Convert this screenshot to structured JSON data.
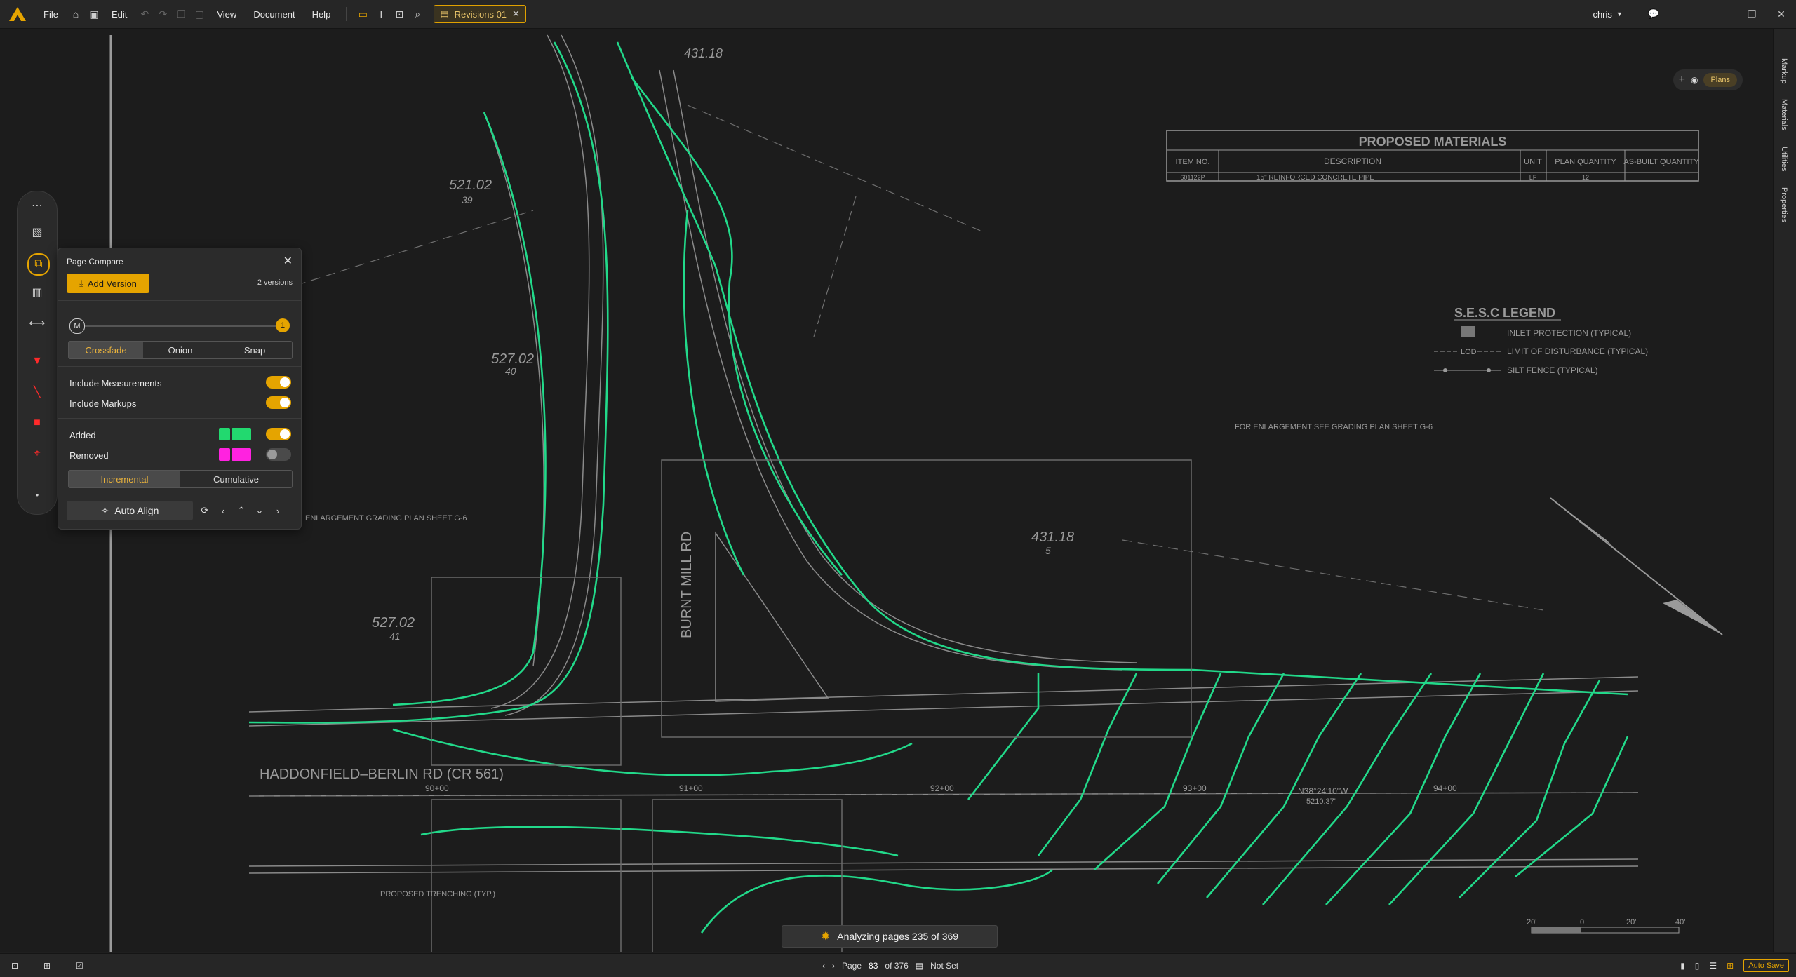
{
  "app": {
    "menus": [
      "File",
      "Edit",
      "View",
      "Document",
      "Help"
    ],
    "tab": {
      "label": "Revisions 01"
    },
    "user": "chris"
  },
  "right_panel_tabs": [
    "Markup",
    "Materials",
    "Utilities",
    "Properties"
  ],
  "top_right": {
    "pill": "Plans"
  },
  "page_compare": {
    "title": "Page Compare",
    "add_version_label": "Add Version",
    "versions_count": "2 versions",
    "slider": {
      "left_marker": "M",
      "right_marker": "1"
    },
    "modes": [
      "Crossfade",
      "Onion",
      "Snap"
    ],
    "active_mode": "Crossfade",
    "include_measurements": {
      "label": "Include Measurements",
      "on": true
    },
    "include_markups": {
      "label": "Include Markups",
      "on": true
    },
    "added": {
      "label": "Added",
      "on": true,
      "color": "#22d96f"
    },
    "removed": {
      "label": "Removed",
      "on": false,
      "color": "#ff22e0"
    },
    "diff_modes": [
      "Incremental",
      "Cumulative"
    ],
    "active_diff": "Incremental",
    "auto_align_label": "Auto Align"
  },
  "drawing": {
    "materials_table": {
      "title": "PROPOSED MATERIALS",
      "headers": [
        "ITEM NO.",
        "DESCRIPTION",
        "UNIT",
        "PLAN QUANTITY",
        "AS-BUILT QUANTITY"
      ],
      "row": [
        "601122P",
        "15\" REINFORCED CONCRETE PIPE",
        "LF",
        "12",
        ""
      ]
    },
    "sesc_legend": {
      "title": "S.E.S.C LEGEND",
      "items": [
        "INLET PROTECTION (TYPICAL)",
        "LIMIT OF DISTURBANCE (TYPICAL)",
        "SILT FENCE (TYPICAL)"
      ],
      "lod": "LOD"
    },
    "labels": {
      "road": "HADDONFIELD–BERLIN RD (CR 561)",
      "burnt_mill": "BURNT MILL RD",
      "enlargement_note": "FOR ENLARGEMENT SEE GRADING PLAN SHEET G-6",
      "enlargement_note_left": "ENLARGEMENT GRADING PLAN SHEET G-6",
      "proposed_trenching": "PROPOSED TRENCHING (TYP.)",
      "bearing": "N38°24'10\"W",
      "bearing_dist": "5210.37'",
      "lots": [
        {
          "top": "431.18",
          "bottom": ""
        },
        {
          "top": "521.02",
          "bottom": "39"
        },
        {
          "top": "527.02",
          "bottom": "40"
        },
        {
          "top": "527.02",
          "bottom": "41"
        },
        {
          "top": "431.18",
          "bottom": "5"
        }
      ],
      "stations": [
        "90+00",
        "91+00",
        "92+00",
        "93+00",
        "94+00"
      ],
      "scale_ticks": [
        "20'",
        "0",
        "20'",
        "40'"
      ]
    }
  },
  "status": {
    "analyzing": "Analyzing pages 235 of 369",
    "page_label": "Page",
    "page_num": "83",
    "page_total": "of 376",
    "scale": "Not Set",
    "auto_save": "Auto Save"
  }
}
